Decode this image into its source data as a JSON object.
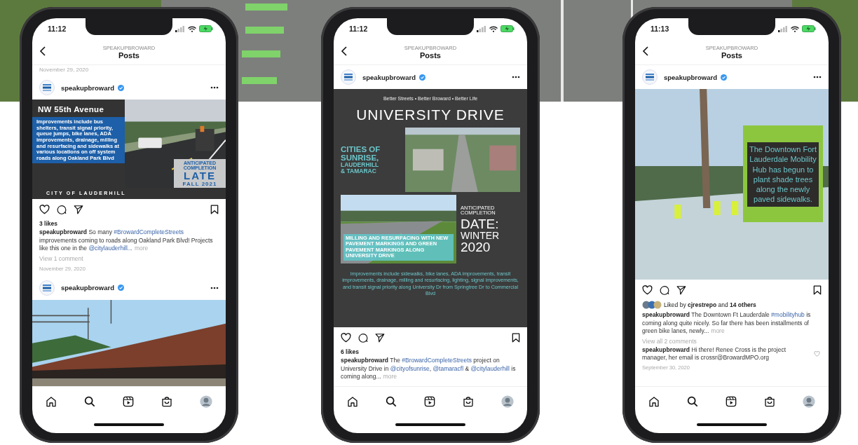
{
  "phones": [
    {
      "time": "11:12",
      "header": {
        "account": "SPEAKUPBROWARD",
        "title": "Posts"
      },
      "feed": [
        {
          "kind": "date",
          "text": "November 29, 2020"
        },
        {
          "kind": "post",
          "account": "speakupbroward",
          "verified": true,
          "media": {
            "kind": "nw55",
            "title": "NW 55th Avenue",
            "body": "Improvements include bus shelters, transit signal priority, queue jumps, bike lanes, ADA improvements, drainage, milling and resurfacing and sidewalks at various locations on off system roads along Oakland Park Blvd",
            "footer": "CITY OF LAUDERHILL",
            "badge_label": "ANTICIPATED COMPLETION",
            "badge_value": "LATE",
            "badge_sub": "FALL 2021"
          },
          "liked": {
            "kind": "count",
            "text": "3 likes"
          },
          "caption": [
            {
              "kind": "user",
              "text": "speakupbroward"
            },
            {
              "kind": "text",
              "text": " So many "
            },
            {
              "kind": "tag",
              "text": "#BrowardCompleteStreets"
            },
            {
              "kind": "text",
              "text": " improvements coming to roads along Oakland Park Blvd! Projects like this one in the "
            },
            {
              "kind": "tag",
              "text": "@citylauderhill..."
            }
          ],
          "more": "more",
          "comments_link": "View 1 comment",
          "date": "November 29, 2020"
        },
        {
          "kind": "post",
          "account": "speakupbroward",
          "verified": true,
          "media": {
            "kind": "train_photo"
          }
        }
      ]
    },
    {
      "time": "11:12",
      "header": {
        "account": "SPEAKUPBROWARD",
        "title": "Posts"
      },
      "feed": [
        {
          "kind": "post",
          "account": "speakupbroward",
          "verified": true,
          "media": {
            "kind": "university",
            "tagline": "Better Streets • Better Broward • Better Life",
            "title": "UNIVERSITY DRIVE",
            "cities": [
              "CITIES OF",
              "SUNRISE,",
              "LAUDERHILL",
              "& TAMARAC"
            ],
            "photo_caption": "MILLING AND RESURFACING WITH NEW PAVEMENT MARKINGS AND GREEN PAVEMENT MARKINGS ALONG UNIVERSITY DRIVE",
            "completion_label": "ANTICIPATED COMPLETION",
            "completion_lines": [
              "DATE:",
              "WINTER",
              "2020"
            ],
            "body": "Improvements include sidewalks, bike lanes, ADA improvements, transit improvements, drainage, milling and resurfacing, lighting, signal improvements, and transit signal priority along University Dr from Springtree Dr to Commercial Blvd"
          },
          "liked": {
            "kind": "count",
            "text": "6 likes"
          },
          "caption": [
            {
              "kind": "user",
              "text": "speakupbroward"
            },
            {
              "kind": "text",
              "text": " The "
            },
            {
              "kind": "tag",
              "text": "#BrowardCompleteStreets"
            },
            {
              "kind": "text",
              "text": " project on University Drive in "
            },
            {
              "kind": "tag",
              "text": "@cityofsunrise"
            },
            {
              "kind": "text",
              "text": ", "
            },
            {
              "kind": "tag",
              "text": "@tamaracfl"
            },
            {
              "kind": "text",
              "text": " & "
            },
            {
              "kind": "tag",
              "text": "@citylauderhill"
            },
            {
              "kind": "text",
              "text": " is coming along..."
            }
          ],
          "more": "more"
        }
      ]
    },
    {
      "time": "11:13",
      "header": {
        "account": "SPEAKUPBROWARD",
        "title": "Posts"
      },
      "feed": [
        {
          "kind": "post",
          "account": "speakupbroward",
          "verified": true,
          "media": {
            "kind": "hub",
            "text": "The Downtown Fort Lauderdale Mobility Hub has begun to plant shade trees along the newly paved sidewalks."
          },
          "liked": {
            "kind": "liked_by",
            "text": "Liked by **cjrestrepo** and **14 others**"
          },
          "caption": [
            {
              "kind": "user",
              "text": "speakupbroward"
            },
            {
              "kind": "text",
              "text": " The Downtown Ft Lauderdale "
            },
            {
              "kind": "tag",
              "text": "#mobilityhub"
            },
            {
              "kind": "text",
              "text": " is coming along quite nicely. So far there has been installments of green bike lanes, newly..."
            }
          ],
          "more": "more",
          "comments_link": "View all 2 comments",
          "comment": [
            {
              "kind": "user",
              "text": "speakupbroward"
            },
            {
              "kind": "text",
              "text": " Hi there! Renee Cross is the project manager, her email is crossr@BrowardMPO.org"
            }
          ],
          "date": "September 30, 2020"
        }
      ]
    }
  ]
}
